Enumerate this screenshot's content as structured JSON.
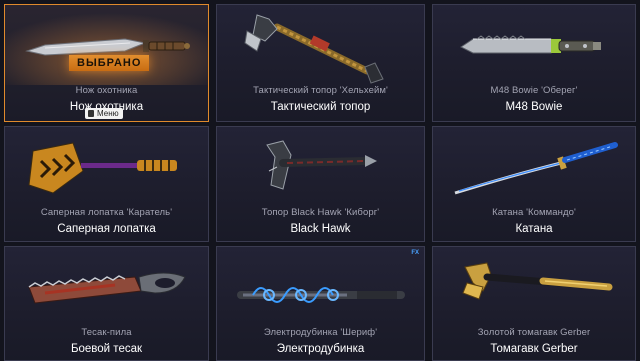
{
  "selected_badge": "ВЫБРАНО",
  "menu_label": "Меню",
  "fx_label": "FX",
  "cards": [
    {
      "subtitle": "Нож охотника",
      "title": "Нож охотника",
      "icon": "hunting-knife"
    },
    {
      "subtitle": "Тактический топор 'Хельхейм'",
      "title": "Тактический топор",
      "icon": "tactical-axe"
    },
    {
      "subtitle": "M48 Bowie 'Оберег'",
      "title": "M48 Bowie",
      "icon": "bowie-knife"
    },
    {
      "subtitle": "Саперная лопатка 'Каратель'",
      "title": "Саперная лопатка",
      "icon": "sapper-shovel"
    },
    {
      "subtitle": "Топор Black Hawk 'Киборг'",
      "title": "Black Hawk",
      "icon": "black-hawk-axe"
    },
    {
      "subtitle": "Катана 'Коммандо'",
      "title": "Катана",
      "icon": "katana"
    },
    {
      "subtitle": "Тесак-пила",
      "title": "Боевой тесак",
      "icon": "saw-machete"
    },
    {
      "subtitle": "Электродубинка 'Шериф'",
      "title": "Электродубинка",
      "icon": "electro-baton"
    },
    {
      "subtitle": "Золотой томагавк Gerber",
      "title": "Томагавк Gerber",
      "icon": "gerber-tomahawk"
    }
  ]
}
